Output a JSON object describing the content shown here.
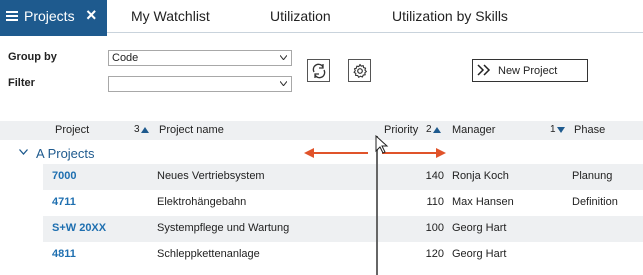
{
  "tabs": {
    "active": {
      "label": "Projects"
    },
    "items": [
      {
        "label": "My Watchlist"
      },
      {
        "label": "Utilization"
      },
      {
        "label": "Utilization by Skills"
      }
    ]
  },
  "controls": {
    "group_by_label": "Group by",
    "group_by_value": "Code",
    "filter_label": "Filter",
    "filter_value": "",
    "new_project_label": "New Project"
  },
  "grid": {
    "columns": {
      "project": "Project",
      "project_sort_order": "3",
      "project_name": "Project name",
      "priority": "Priority",
      "priority_sort_order": "2",
      "manager": "Manager",
      "manager_sort_order": "1",
      "phase": "Phase"
    },
    "group": {
      "label": "A Projects"
    },
    "rows": [
      {
        "code": "7000",
        "name": "Neues Vertriebsystem",
        "priority": "140",
        "manager": "Ronja Koch",
        "phase": "Planung"
      },
      {
        "code": "4711",
        "name": "Elektrohängebahn",
        "priority": "110",
        "manager": "Max Hansen",
        "phase": "Definition"
      },
      {
        "code": "S+W 20XX",
        "name": "Systempflege und Wartung",
        "priority": "100",
        "manager": "Georg Hart",
        "phase": ""
      },
      {
        "code": "4811",
        "name": "Schleppkettenanlage",
        "priority": "120",
        "manager": "Georg Hart",
        "phase": ""
      }
    ]
  },
  "colors": {
    "accent": "#1e5a8e",
    "link": "#1e6fb0",
    "drag_arrow": "#e0532a",
    "row_alt": "#eef0f2"
  },
  "icons": {
    "menu": "hamburger-icon",
    "close": "close-icon",
    "refresh": "refresh-icon",
    "settings": "gear-icon",
    "new_project": "double-chevron-right-icon",
    "group_toggle": "chevron-down-icon"
  }
}
